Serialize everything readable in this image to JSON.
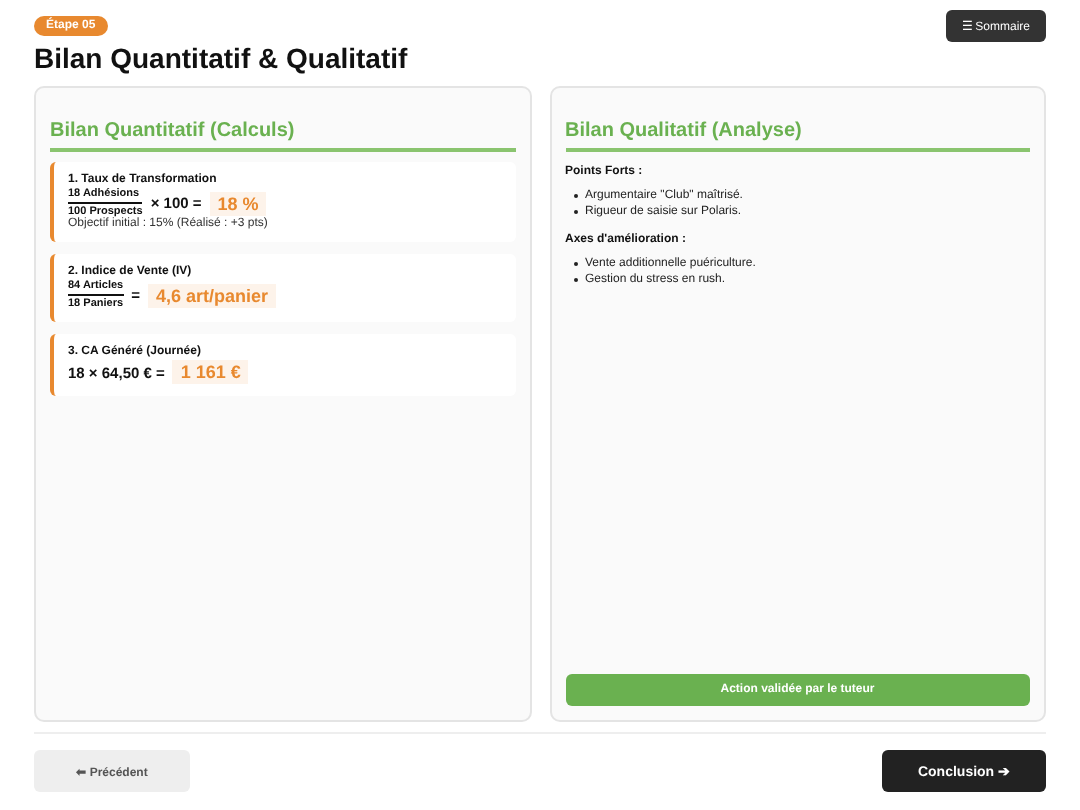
{
  "header": {
    "step_badge": "Étape 05",
    "title": "Bilan Quantitatif & Qualitatif",
    "summary_button": "☰ Sommaire"
  },
  "quantitative": {
    "heading": "Bilan Quantitatif (Calculs)",
    "items": [
      {
        "kind": "fraction",
        "title": "1. Taux de Transformation",
        "numerator": "18 Adhésions",
        "denominator": "100 Prospects",
        "operator": "× 100 =",
        "result": "18 %",
        "note": "Objectif initial : 15% (Réalisé : +3 pts)"
      },
      {
        "kind": "fraction",
        "title": "2. Indice de Vente (IV)",
        "numerator": "84 Articles",
        "denominator": "18 Paniers",
        "operator": "=",
        "result": "4,6 art/panier"
      },
      {
        "kind": "product",
        "title": "3. CA Généré (Journée)",
        "expression": "18 × 64,50 € =",
        "result": "1 161 €"
      }
    ]
  },
  "qualitative": {
    "heading": "Bilan Qualitatif (Analyse)",
    "sections": [
      {
        "label": "Points Forts :",
        "bullets": [
          "Argumentaire \"Club\" maîtrisé.",
          "Rigueur de saisie sur Polaris."
        ]
      },
      {
        "label": "Axes d'amélioration :",
        "bullets": [
          "Vente additionnelle puériculture.",
          "Gestion du stress en rush."
        ]
      }
    ],
    "validation": "Action validée par le tuteur"
  },
  "footer": {
    "previous": "⬅ Précédent",
    "next": "Conclusion ➔"
  }
}
